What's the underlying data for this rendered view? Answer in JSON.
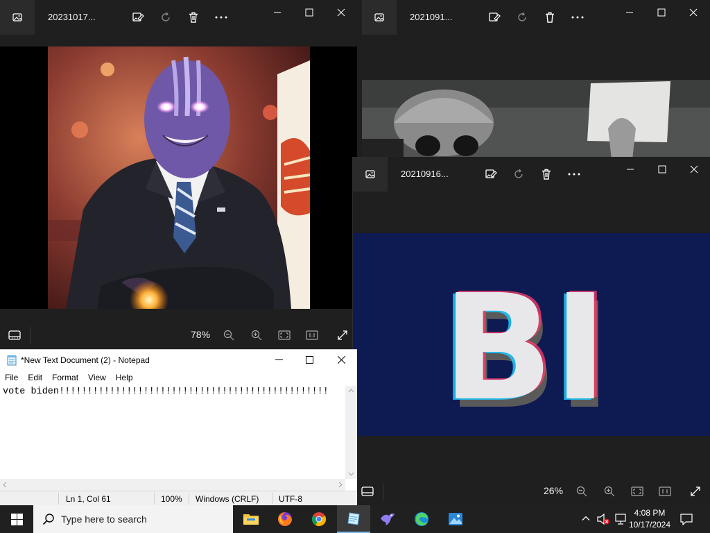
{
  "viewer1": {
    "title": "20231017...",
    "zoom": "78%",
    "controls": {
      "minimize_icon": "minimize-icon",
      "maximize_icon": "maximize-icon",
      "close_icon": "close-icon"
    }
  },
  "viewer2": {
    "title": "2021091..."
  },
  "viewer3": {
    "title": "20210916...",
    "zoom": "26%",
    "image_text": "BI"
  },
  "notepad": {
    "title": "*New Text Document (2) - Notepad",
    "menu": [
      "File",
      "Edit",
      "Format",
      "View",
      "Help"
    ],
    "content": "vote biden!!!!!!!!!!!!!!!!!!!!!!!!!!!!!!!!!!!!!!!!!!!!!!!!",
    "status": {
      "position": "Ln 1, Col 61",
      "zoom": "100%",
      "line_ending": "Windows (CRLF)",
      "encoding": "UTF-8"
    }
  },
  "taskbar": {
    "search_placeholder": "Type here to search",
    "time": "4:08 PM",
    "date": "10/17/2024",
    "apps": [
      "file-explorer-icon",
      "firefox-icon",
      "chrome-icon",
      "notepad-icon",
      "bird-app-icon",
      "edge-icon",
      "photos-icon"
    ]
  },
  "colors": {
    "window_bg": "#1f1f1f",
    "taskbar_bg": "#202020",
    "glitch_bg": "#0e1a52"
  }
}
